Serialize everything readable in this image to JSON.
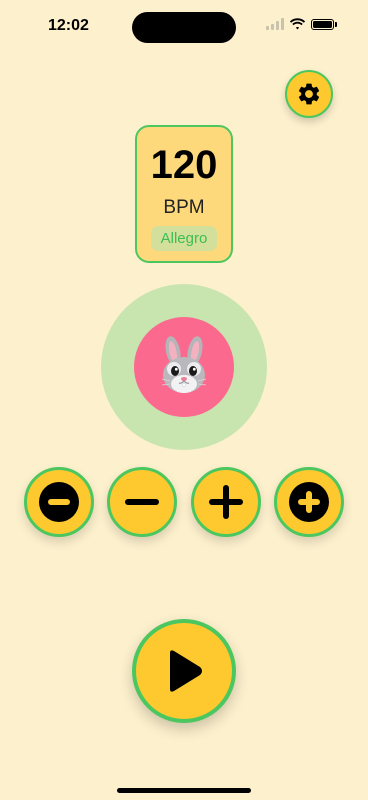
{
  "status_bar": {
    "time": "12:02",
    "battery_level": 1.0
  },
  "settings": {
    "icon": "gear-icon"
  },
  "tempo": {
    "bpm": "120",
    "unit": "BPM",
    "marking": "Allegro"
  },
  "beat_indicator": {
    "icon": "rabbit-face-icon",
    "ring_color": "#c8e5b0",
    "core_color": "#fb6a8e"
  },
  "controls": {
    "buttons": [
      {
        "icon": "minus-circle-icon"
      },
      {
        "icon": "minus-icon"
      },
      {
        "icon": "plus-icon"
      },
      {
        "icon": "plus-circle-icon"
      }
    ],
    "play_icon": "play-icon"
  },
  "colors": {
    "background": "#fdf0cd",
    "button_fill": "#fdc92f",
    "accent_green": "#4cc75f",
    "card_fill": "#fdd97c"
  }
}
